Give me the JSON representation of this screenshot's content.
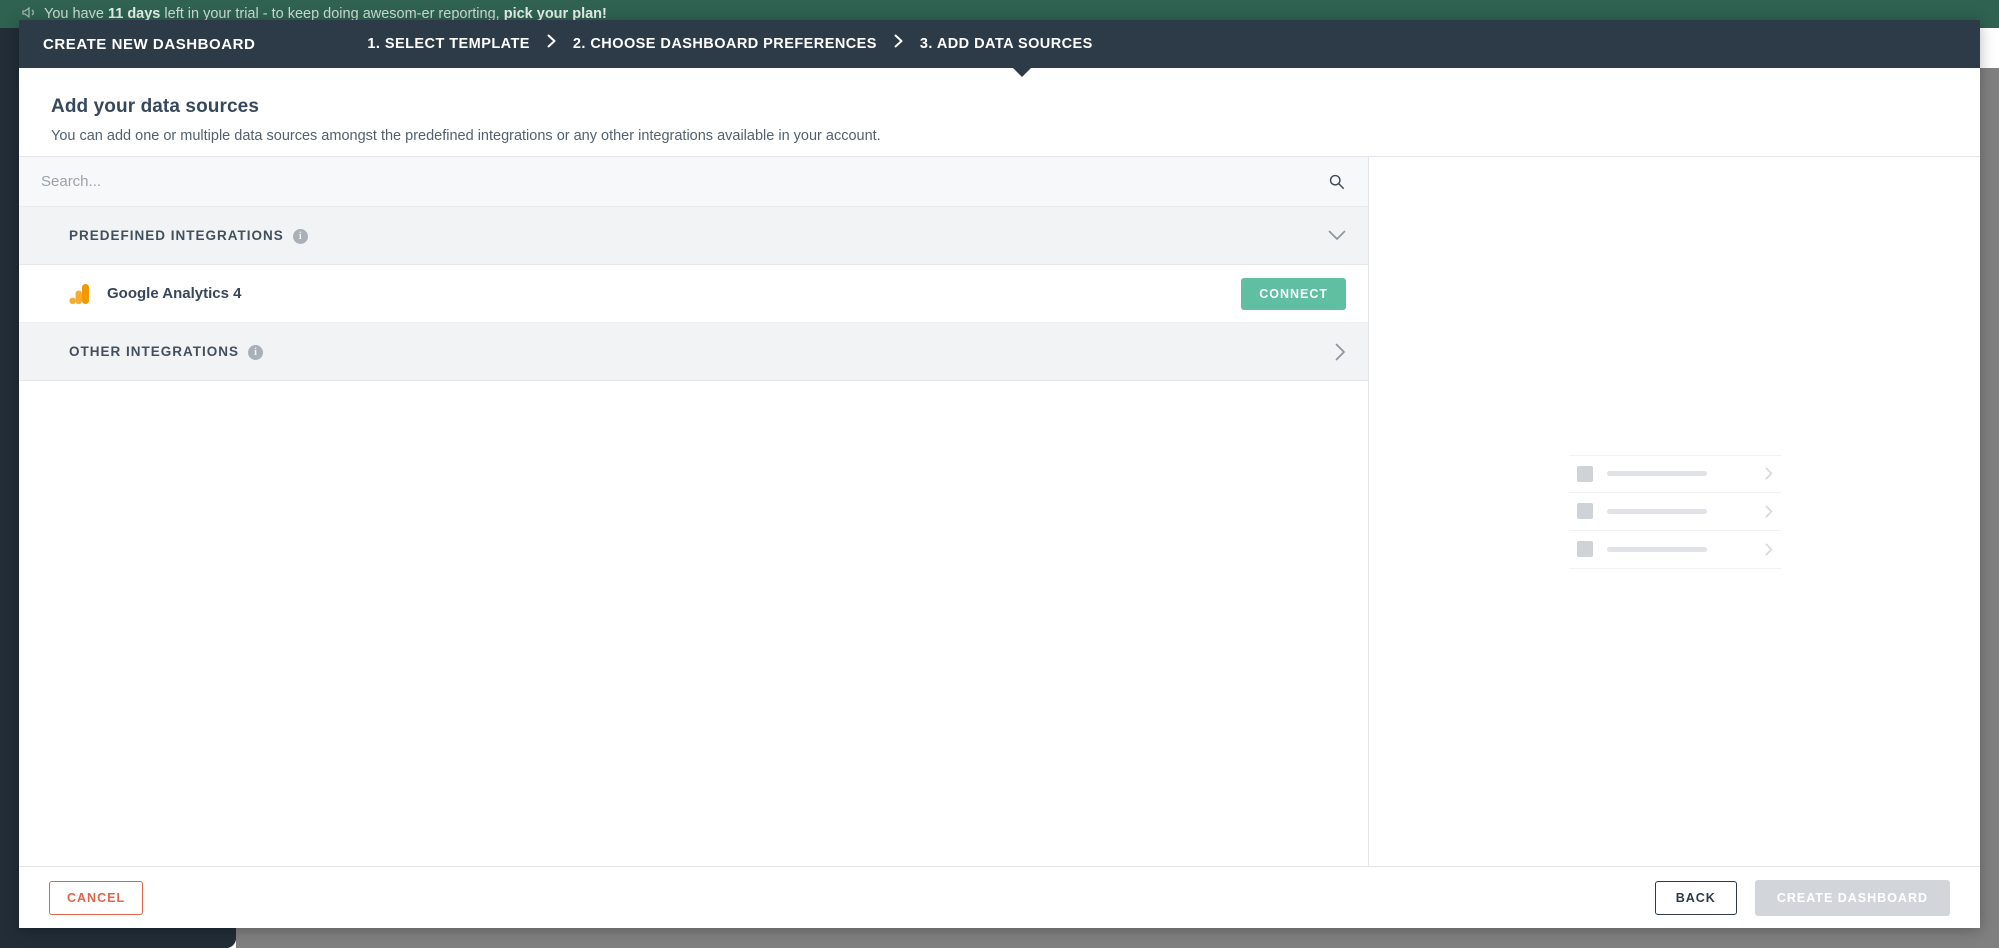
{
  "background": {
    "trial_banner": {
      "icon": "megaphone-icon",
      "prefix": "You have ",
      "days": "11 days",
      "middle": " left in your trial - to keep doing awesom-er reporting, ",
      "cta": "pick your plan!"
    }
  },
  "modal": {
    "title": "CREATE NEW DASHBOARD",
    "steps": [
      {
        "label": "1. SELECT TEMPLATE"
      },
      {
        "label": "2. CHOOSE DASHBOARD PREFERENCES"
      },
      {
        "label": "3. ADD DATA SOURCES"
      }
    ],
    "step_separator": "›",
    "intro": {
      "title": "Add your data sources",
      "subtitle": "You can add one or multiple data sources amongst the predefined integrations or any other integrations available in your account."
    },
    "search": {
      "placeholder": "Search...",
      "value": "",
      "icon": "search-icon"
    },
    "sections": [
      {
        "title": "PREDEFINED INTEGRATIONS",
        "info_icon": "info-icon",
        "toggle_icon": "chevron-down-icon",
        "expanded": true
      },
      {
        "title": "OTHER INTEGRATIONS",
        "info_icon": "info-icon",
        "toggle_icon": "chevron-right-icon",
        "expanded": false
      }
    ],
    "integrations": [
      {
        "name": "Google Analytics 4",
        "icon": "google-analytics-icon",
        "action_label": "CONNECT"
      }
    ],
    "right_panel": {
      "placeholder_rows": 3,
      "row_icon": "chevron-right-icon"
    },
    "footer": {
      "cancel_label": "CANCEL",
      "back_label": "BACK",
      "create_label": "CREATE DASHBOARD",
      "create_disabled": true
    }
  },
  "colors": {
    "banner_green": "#2f6251",
    "header_dark": "#2d3b48",
    "connect_teal": "#5fbfa0",
    "cancel_red": "#e0644a",
    "disabled_grey": "#d2d6db",
    "ga_orange": "#f29900",
    "ga_yellow": "#f9ab30"
  }
}
